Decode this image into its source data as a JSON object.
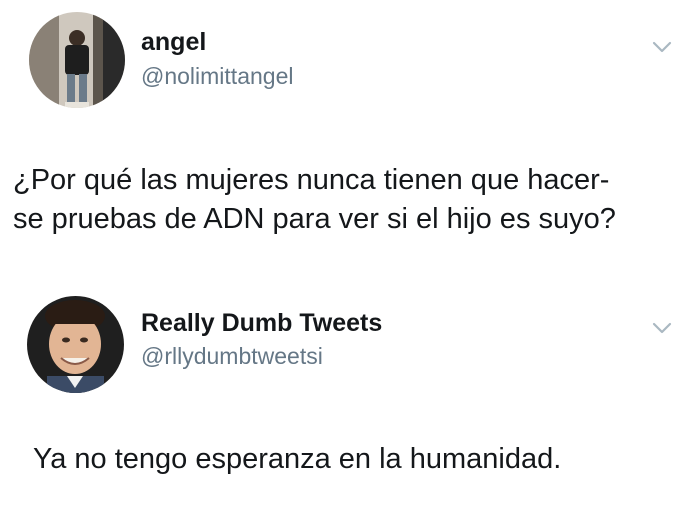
{
  "tweets": [
    {
      "display_name": "angel",
      "handle": "@nolimittangel",
      "text_lines": [
        "¿Por qué las mujeres nunca tienen que hacer-",
        "se pruebas de ADN para ver si el hijo es suyo?"
      ],
      "avatar_icon": "user-photo-avatar",
      "menu_icon": "chevron-down-icon"
    },
    {
      "display_name": "Really Dumb Tweets",
      "handle": "@rllydumbtweetsi",
      "text_lines": [
        "Ya no tengo esperanza en la humanidad."
      ],
      "avatar_icon": "user-photo-avatar",
      "menu_icon": "chevron-down-icon"
    }
  ],
  "colors": {
    "text_primary": "#14171a",
    "text_secondary": "#657786",
    "chevron": "#aab8c2",
    "background": "#ffffff"
  }
}
